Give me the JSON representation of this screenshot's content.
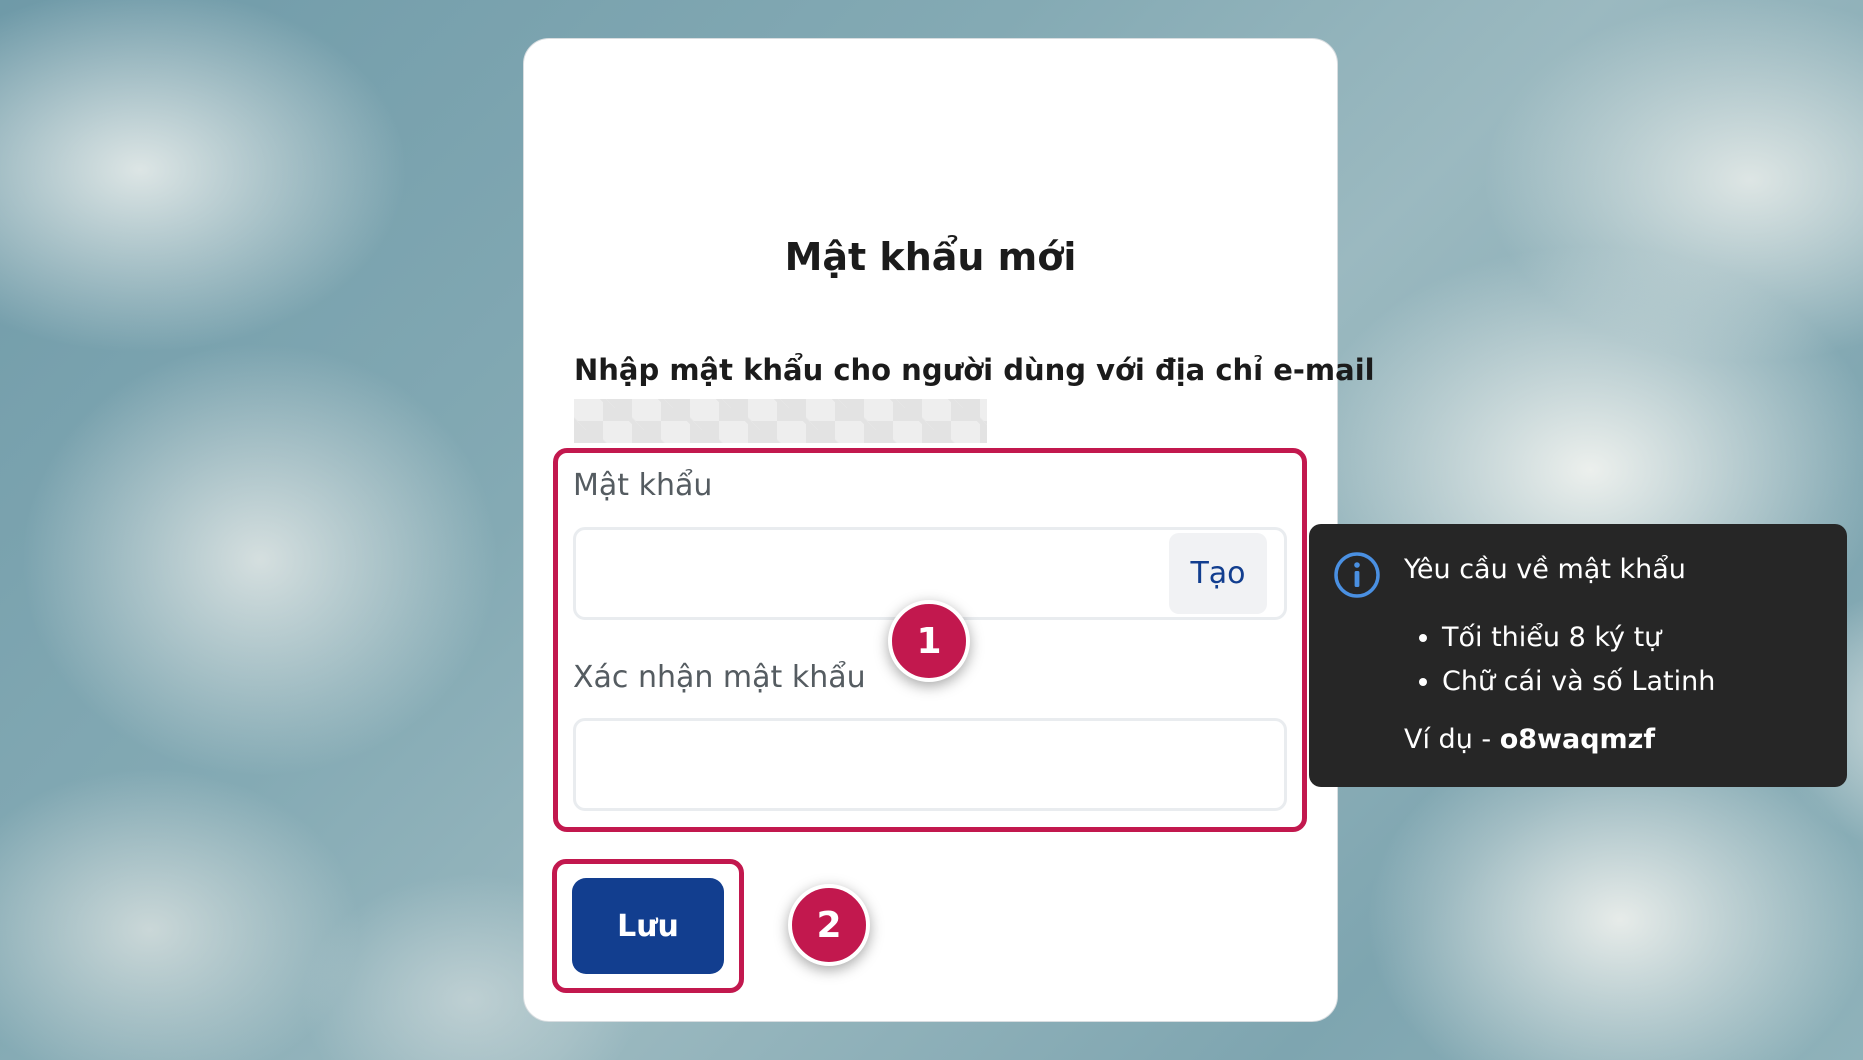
{
  "card": {
    "title": "Mật khẩu mới",
    "instruction": "Nhập mật khẩu cho người dùng với địa chỉ e-mail"
  },
  "form": {
    "password_label": "Mật khẩu",
    "password_value": "",
    "generate_button": "Tạo",
    "confirm_label": "Xác nhận mật khẩu",
    "confirm_value": "",
    "save_button": "Lưu"
  },
  "markers": {
    "first": "1",
    "second": "2"
  },
  "tooltip": {
    "title": "Yêu cầu về mật khẩu",
    "rules": [
      "Tối thiểu 8 ký tự",
      "Chữ cái và số Latinh"
    ],
    "example_prefix": "Ví dụ - ",
    "example_value": "o8waqmzf",
    "icon": "info-icon"
  },
  "colors": {
    "accent": "#123e8f",
    "highlight": "#c2184e",
    "tooltip_bg": "#262626"
  }
}
